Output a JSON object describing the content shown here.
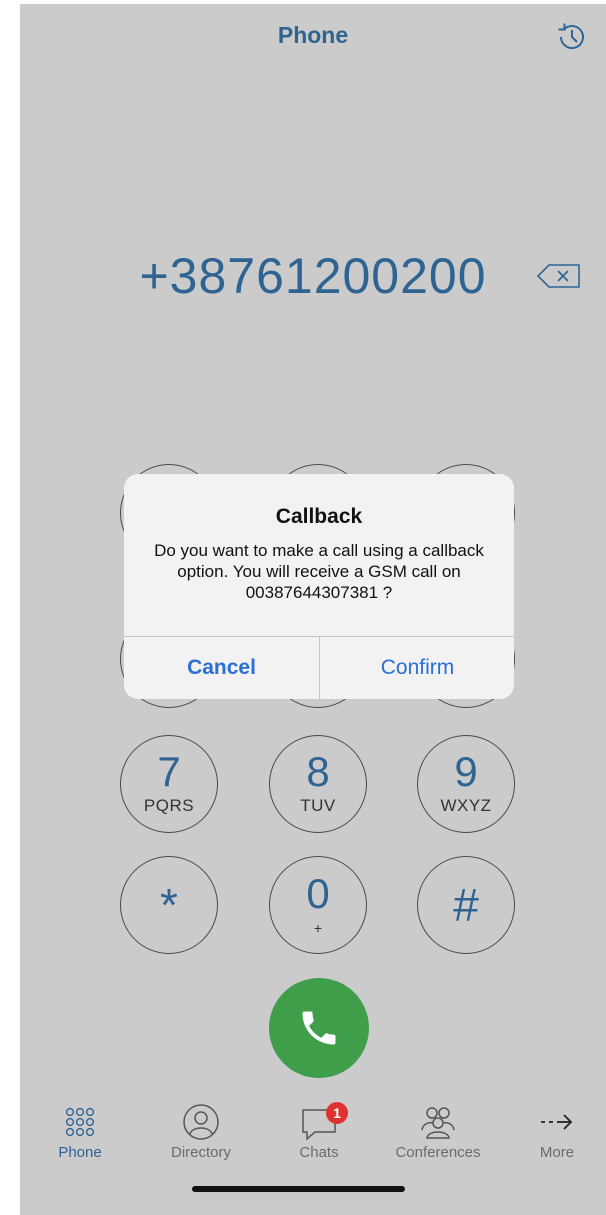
{
  "header": {
    "title": "Phone",
    "history_icon": "clock-history-icon"
  },
  "dialer": {
    "number": "+38761200200",
    "backspace_icon": "backspace-icon"
  },
  "keypad": {
    "keys": [
      {
        "digit": "7",
        "letters": "PQRS"
      },
      {
        "digit": "8",
        "letters": "TUV"
      },
      {
        "digit": "9",
        "letters": "WXYZ"
      },
      {
        "digit": "*",
        "letters": ""
      },
      {
        "digit": "0",
        "letters": "+"
      },
      {
        "digit": "#",
        "letters": ""
      }
    ]
  },
  "call_button": {
    "icon": "phone-handset-icon",
    "color": "#3f9e49"
  },
  "tabs": [
    {
      "label": "Phone",
      "icon": "keypad-grid-icon",
      "active": true
    },
    {
      "label": "Directory",
      "icon": "person-icon",
      "active": false
    },
    {
      "label": "Chats",
      "icon": "chat-bubble-icon",
      "active": false,
      "badge": "1"
    },
    {
      "label": "Conferences",
      "icon": "group-icon",
      "active": false
    },
    {
      "label": "More",
      "icon": "arrow-right-icon",
      "active": false
    }
  ],
  "dialog": {
    "title": "Callback",
    "message": "Do you want to make a call using a callback option. You will receive a GSM call on 00387644307381 ?",
    "cancel_label": "Cancel",
    "confirm_label": "Confirm"
  },
  "colors": {
    "accent": "#2f6492",
    "background": "#cbcbcb",
    "badge": "#e03030",
    "link": "#2a6fd6"
  }
}
